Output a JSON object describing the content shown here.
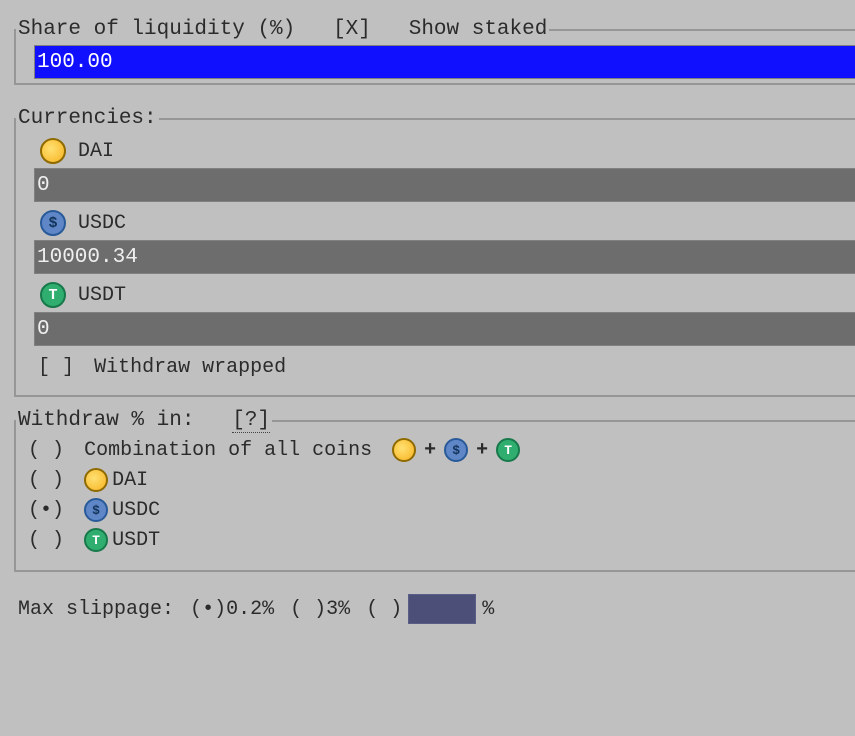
{
  "share": {
    "legend_prefix": "Share of liquidity (%)",
    "show_staked_label": "Show staked",
    "show_staked_checked": "X",
    "value": "100.00"
  },
  "currencies": {
    "legend": "Currencies:",
    "list": [
      {
        "symbol": "DAI",
        "icon": "dai",
        "value": "0"
      },
      {
        "symbol": "USDC",
        "icon": "usdc",
        "value": "10000.34"
      },
      {
        "symbol": "USDT",
        "icon": "usdt",
        "value": "0"
      }
    ],
    "withdraw_wrapped": {
      "label": "Withdraw wrapped",
      "mark": " "
    }
  },
  "withdraw_in": {
    "legend_prefix": "Withdraw % in:",
    "help_glyph": "[?]",
    "options": [
      {
        "label": "Combination of all coins",
        "selected": " ",
        "combo": true
      },
      {
        "label": "DAI",
        "selected": " ",
        "icon": "dai"
      },
      {
        "label": "USDC",
        "selected": "•",
        "icon": "usdc"
      },
      {
        "label": "USDT",
        "selected": " ",
        "icon": "usdt"
      }
    ]
  },
  "slippage": {
    "label": "Max slippage:",
    "options": [
      {
        "label": "0.2%",
        "selected": "•"
      },
      {
        "label": "3%",
        "selected": " "
      }
    ],
    "custom_selected": " ",
    "custom_value": "",
    "suffix": "%"
  },
  "glyph": {
    "lb": "[",
    "rb": "]",
    "lp": "(",
    "rp": ")",
    "plus": "+"
  }
}
